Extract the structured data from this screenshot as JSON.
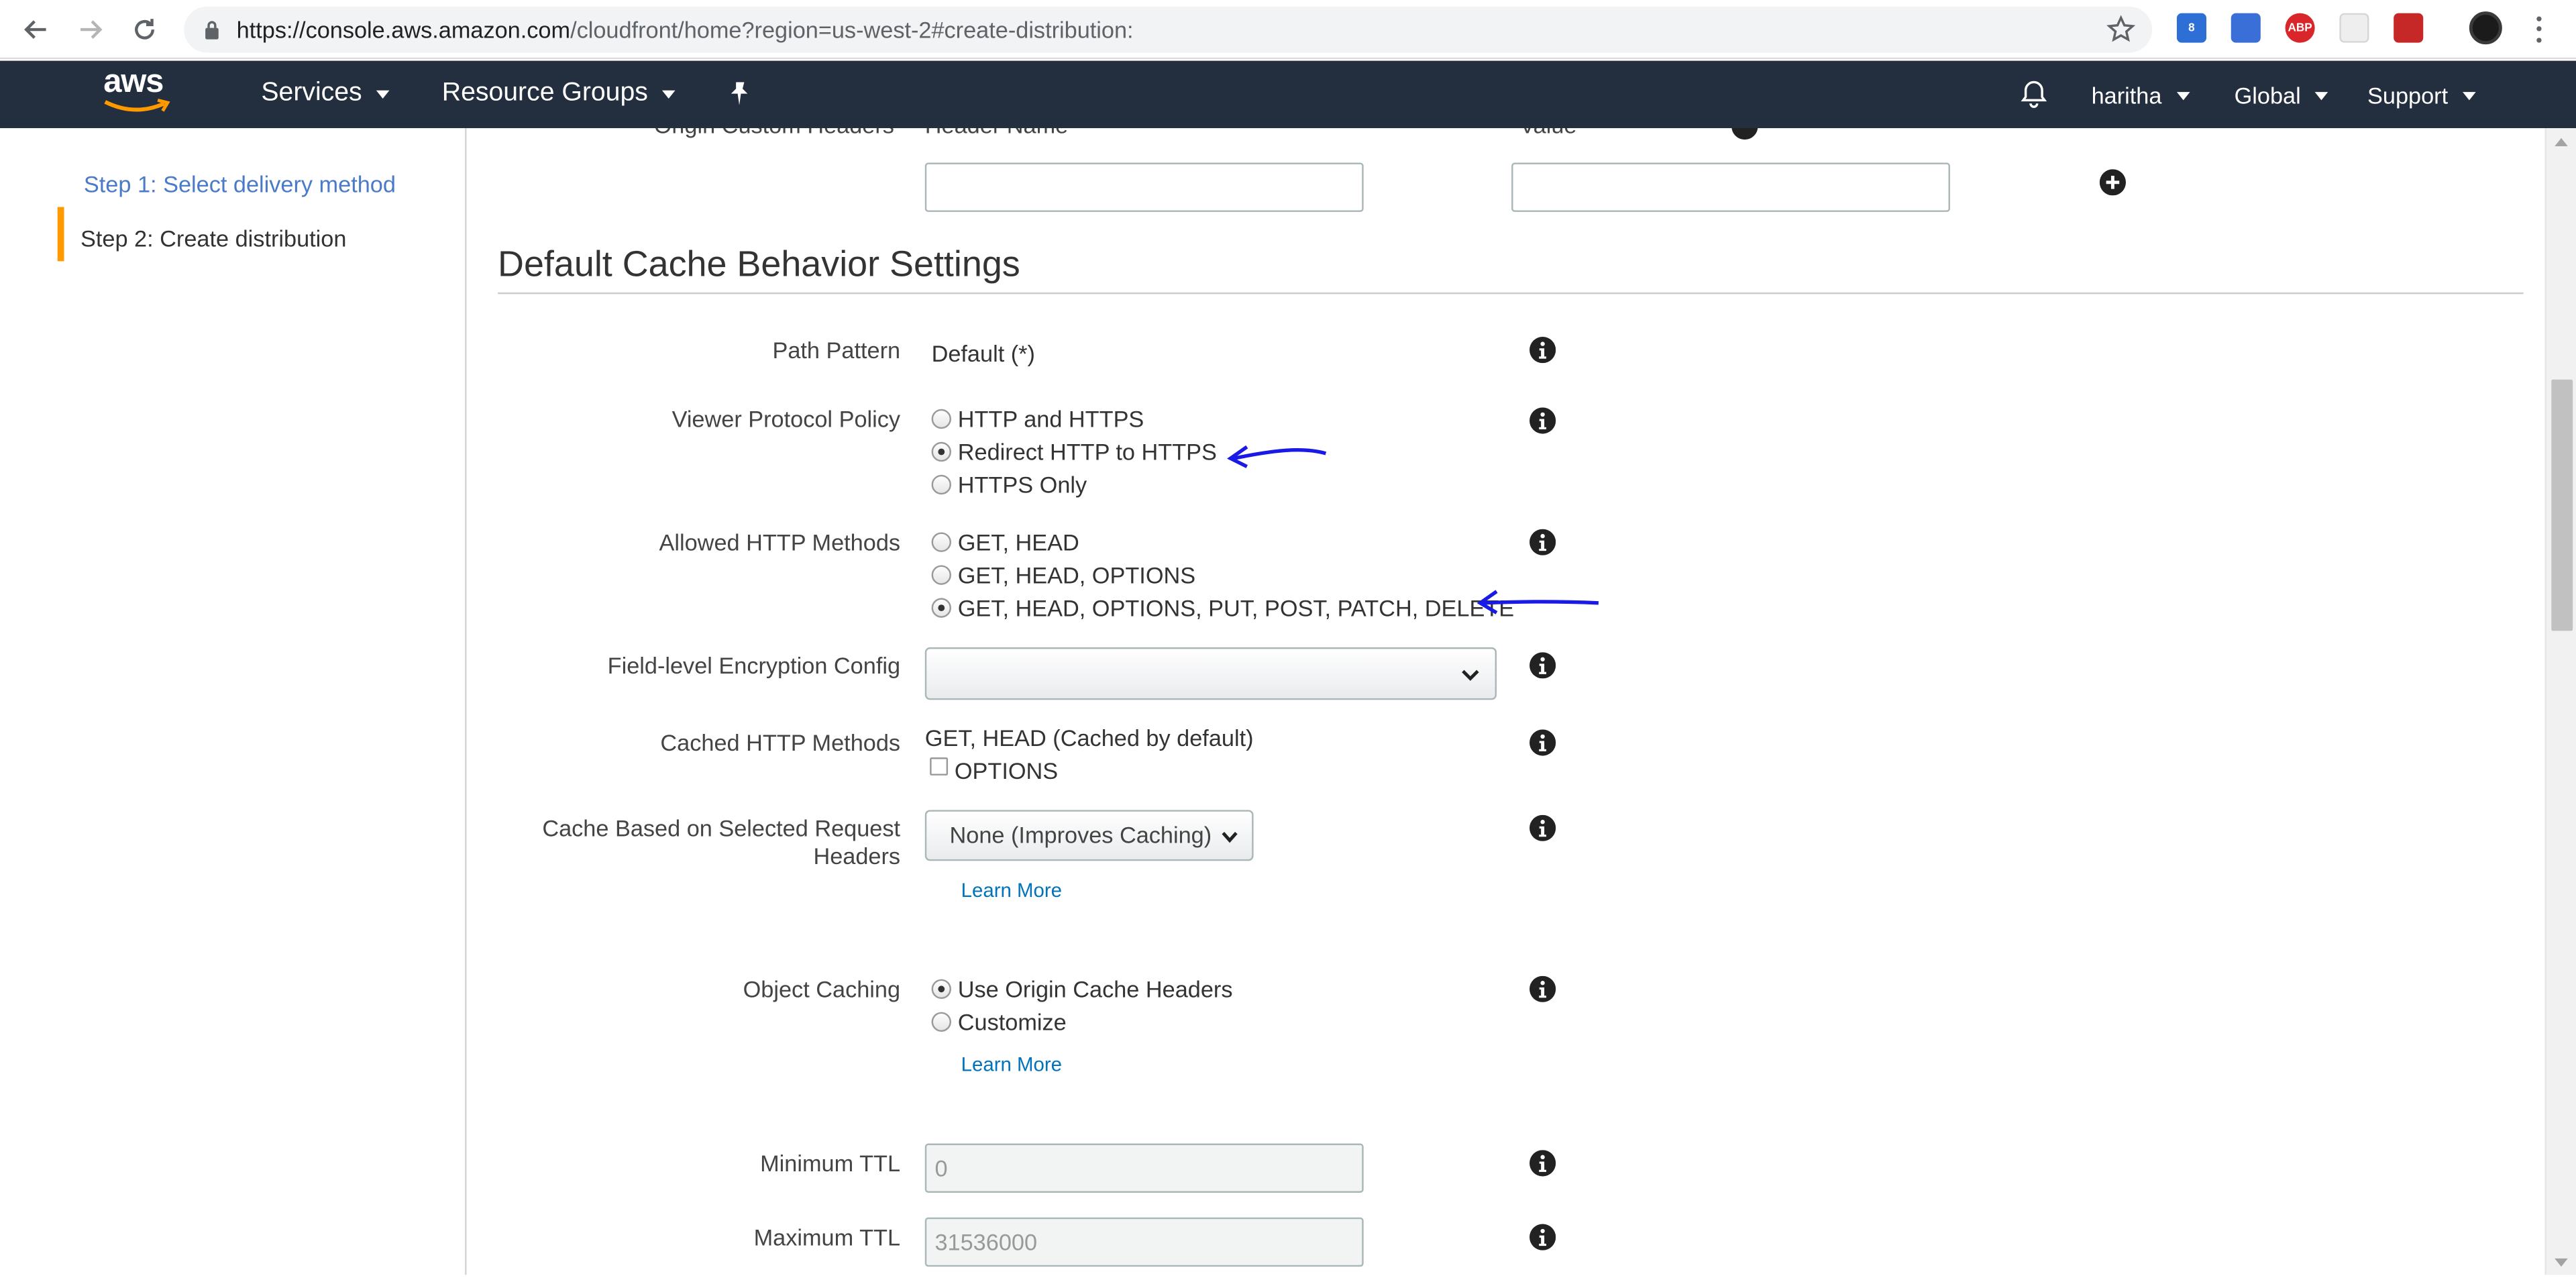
{
  "browser": {
    "url_main": "https://console.aws.amazon.com",
    "url_path": "/cloudfront/home?region=us-west-2#create-distribution:",
    "extensions": [
      "extension-a-icon",
      "extension-b-icon",
      "adblock-icon",
      "extension-d-icon",
      "extension-e-icon"
    ],
    "adblock_label": "ABP"
  },
  "aws_nav": {
    "logo": "aws",
    "services": "Services",
    "resource_groups": "Resource Groups",
    "user": "haritha",
    "region": "Global",
    "support": "Support"
  },
  "sidebar": {
    "steps": [
      {
        "label": "Step 1: Select delivery method",
        "active": false
      },
      {
        "label": "Step 2: Create distribution",
        "active": true
      }
    ]
  },
  "origin_headers": {
    "label": "Origin Custom Headers",
    "header_name_col": "Header Name",
    "value_col": "Value",
    "header_name_value": "",
    "value_value": ""
  },
  "section": {
    "title": "Default Cache Behavior Settings"
  },
  "form": {
    "path_pattern": {
      "label": "Path Pattern",
      "value": "Default (*)"
    },
    "viewer_protocol": {
      "label": "Viewer Protocol Policy",
      "options": [
        "HTTP and HTTPS",
        "Redirect HTTP to HTTPS",
        "HTTPS Only"
      ],
      "selected": "Redirect HTTP to HTTPS"
    },
    "allowed_methods": {
      "label": "Allowed HTTP Methods",
      "options": [
        "GET, HEAD",
        "GET, HEAD, OPTIONS",
        "GET, HEAD, OPTIONS, PUT, POST, PATCH, DELETE"
      ],
      "selected": "GET, HEAD, OPTIONS, PUT, POST, PATCH, DELETE"
    },
    "field_encryption": {
      "label": "Field-level Encryption Config",
      "value": ""
    },
    "cached_methods": {
      "label": "Cached HTTP Methods",
      "default_text": "GET, HEAD (Cached by default)",
      "options_label": "OPTIONS",
      "options_checked": false
    },
    "cache_headers": {
      "label_line1": "Cache Based on Selected Request",
      "label_line2": "Headers",
      "value": "None (Improves Caching)",
      "learn_more": "Learn More"
    },
    "object_caching": {
      "label": "Object Caching",
      "options": [
        "Use Origin Cache Headers",
        "Customize"
      ],
      "selected": "Use Origin Cache Headers",
      "learn_more": "Learn More"
    },
    "min_ttl": {
      "label": "Minimum TTL",
      "value": "0"
    },
    "max_ttl": {
      "label": "Maximum TTL",
      "value": "31536000"
    }
  },
  "colors": {
    "aws_nav_bg": "#232f3e",
    "step_accent": "#ff9900",
    "link": "#0073bb",
    "annotation_arrow": "#1a1ae6"
  }
}
